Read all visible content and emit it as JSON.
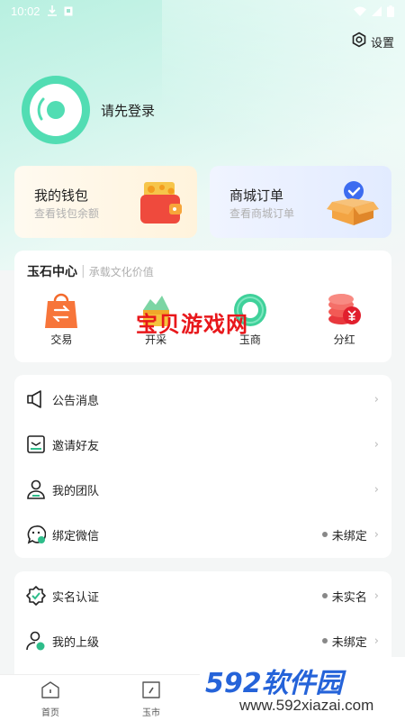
{
  "status_bar": {
    "time": "10:02"
  },
  "header": {
    "settings_label": "设置"
  },
  "profile": {
    "login_prompt": "请先登录"
  },
  "cards": {
    "wallet": {
      "title": "我的钱包",
      "subtitle": "查看钱包余额"
    },
    "orders": {
      "title": "商城订单",
      "subtitle": "查看商城订单"
    }
  },
  "jade_center": {
    "title": "玉石中心",
    "subtitle": "承载文化价值",
    "items": [
      {
        "label": "交易",
        "icon": "bag-transfer-icon"
      },
      {
        "label": "开采",
        "icon": "mining-icon"
      },
      {
        "label": "玉商",
        "icon": "jade-ring-icon"
      },
      {
        "label": "分红",
        "icon": "coin-stack-icon"
      }
    ]
  },
  "menu_group_1": [
    {
      "label": "公告消息",
      "icon": "announcement-icon",
      "status": ""
    },
    {
      "label": "邀请好友",
      "icon": "invite-icon",
      "status": ""
    },
    {
      "label": "我的团队",
      "icon": "team-icon",
      "status": ""
    },
    {
      "label": "绑定微信",
      "icon": "wechat-icon",
      "status": "未绑定"
    }
  ],
  "menu_group_2": [
    {
      "label": "实名认证",
      "icon": "verified-icon",
      "status": "未实名"
    },
    {
      "label": "我的上级",
      "icon": "superior-icon",
      "status": "未绑定"
    }
  ],
  "tabbar": [
    {
      "label": "首页",
      "icon": "home-icon"
    },
    {
      "label": "玉市",
      "icon": "market-icon"
    }
  ],
  "watermark": {
    "text": "宝贝游戏网"
  },
  "brand": {
    "logo_num": "592",
    "logo_cn": "软件园",
    "url": "www.592xiazai.com"
  },
  "colors": {
    "accent": "#52ddb3",
    "brand_blue": "#2563d9",
    "watermark_red": "#e8171b"
  }
}
